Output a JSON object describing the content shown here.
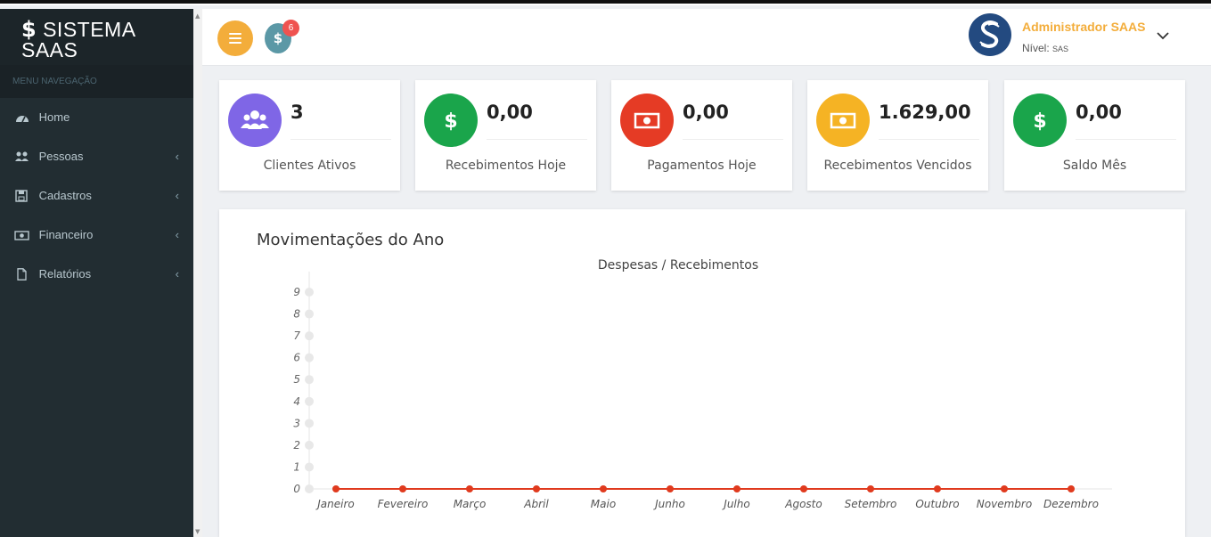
{
  "brand": {
    "symbol": "$",
    "line1": "SISTEMA",
    "line2": "SAAS"
  },
  "sidebar": {
    "header": "MENU NAVEGAÇÃO",
    "items": [
      {
        "label": "Home",
        "icon": "dashboard-icon",
        "has_submenu": false
      },
      {
        "label": "Pessoas",
        "icon": "users-icon",
        "has_submenu": true
      },
      {
        "label": "Cadastros",
        "icon": "floppy-disk-icon",
        "has_submenu": true
      },
      {
        "label": "Financeiro",
        "icon": "money-bill-icon",
        "has_submenu": true
      },
      {
        "label": "Relatórios",
        "icon": "file-icon",
        "has_submenu": true
      }
    ]
  },
  "header": {
    "notification_symbol": "$",
    "notification_count": "6",
    "user_name": "Administrador SAAS",
    "user_level_label": "Nível:",
    "user_level_value": "SAS",
    "colors": {
      "accent": "#f3ad3b",
      "notification": "#5b98a6",
      "badge": "#ef5350",
      "avatar": "#234a80"
    }
  },
  "cards": [
    {
      "value": "3",
      "label": "Clientes Ativos",
      "icon": "users-icon",
      "color": "#7f66e6"
    },
    {
      "value": "0,00",
      "label": "Recebimentos Hoje",
      "icon": "dollar-icon",
      "color": "#1aa54b"
    },
    {
      "value": "0,00",
      "label": "Pagamentos Hoje",
      "icon": "money-bill-icon",
      "color": "#e53b25"
    },
    {
      "value": "1.629,00",
      "label": "Recebimentos Vencidos",
      "icon": "money-bill-icon",
      "color": "#f5b324"
    },
    {
      "value": "0,00",
      "label": "Saldo Mês",
      "icon": "dollar-icon",
      "color": "#1aa54b"
    }
  ],
  "panel": {
    "title": "Movimentações do Ano"
  },
  "chart_data": {
    "type": "line",
    "title": "Despesas / Recebimentos",
    "categories": [
      "Janeiro",
      "Fevereiro",
      "Março",
      "Abril",
      "Maio",
      "Junho",
      "Julho",
      "Agosto",
      "Setembro",
      "Outubro",
      "Novembro",
      "Dezembro"
    ],
    "series": [
      {
        "values": [
          0,
          0,
          0,
          0,
          0,
          0,
          0,
          0,
          0,
          0,
          0,
          0
        ],
        "color": "#e03a1e"
      }
    ],
    "y_ticks": [
      0,
      1,
      2,
      3,
      4,
      5,
      6,
      7,
      8,
      9
    ],
    "ylim": [
      0,
      9
    ],
    "grid": false,
    "legend": "none"
  }
}
